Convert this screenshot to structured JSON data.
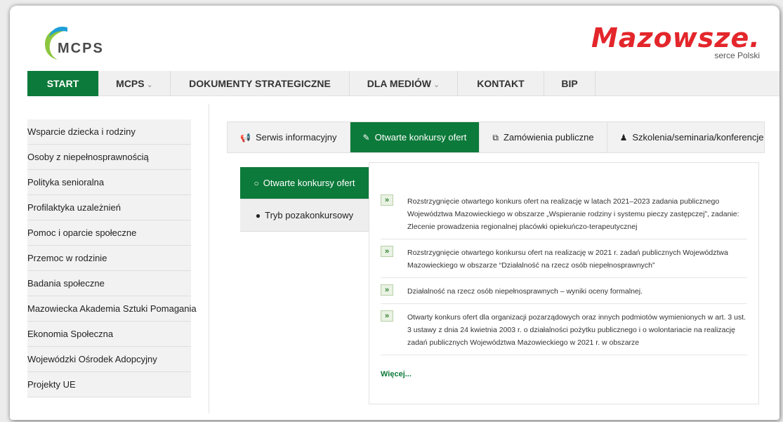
{
  "header": {
    "mcps_logo_text": "MCPS",
    "mazowsze_logo_text": "Mazowsze.",
    "mazowsze_tagline": "serce Polski"
  },
  "nav": {
    "items": [
      {
        "label": "START",
        "active": true,
        "dropdown": false
      },
      {
        "label": "MCPS",
        "active": false,
        "dropdown": true
      },
      {
        "label": "DOKUMENTY STRATEGICZNE",
        "active": false,
        "dropdown": false
      },
      {
        "label": "DLA MEDIÓW",
        "active": false,
        "dropdown": true
      },
      {
        "label": "KONTAKT",
        "active": false,
        "dropdown": false
      },
      {
        "label": "BIP",
        "active": false,
        "dropdown": false
      }
    ]
  },
  "sidebar": {
    "items": [
      {
        "label": "Wsparcie dziecka i rodziny"
      },
      {
        "label": "Osoby z niepełnosprawnością"
      },
      {
        "label": "Polityka senioralna"
      },
      {
        "label": "Profilaktyka uzależnień"
      },
      {
        "label": "Pomoc i oparcie społeczne"
      },
      {
        "label": "Przemoc w rodzinie"
      },
      {
        "label": "Badania społeczne"
      },
      {
        "label": "Mazowiecka Akademia Sztuki Pomagania"
      },
      {
        "label": "Ekonomia Społeczna"
      },
      {
        "label": "Wojewódzki Ośrodek Adopcyjny"
      },
      {
        "label": "Projekty UE"
      }
    ]
  },
  "tabs": [
    {
      "label": "Serwis informacyjny",
      "icon": "megaphone-icon",
      "glyph": "📢",
      "active": false
    },
    {
      "label": "Otwarte konkursy ofert",
      "icon": "edit-icon",
      "glyph": "✎",
      "active": true
    },
    {
      "label": "Zamówienia publiczne",
      "icon": "copy-icon",
      "glyph": "⧉",
      "active": false
    },
    {
      "label": "Szkolenia/seminaria/konferencje",
      "icon": "user-icon",
      "glyph": "♟",
      "active": false
    }
  ],
  "subtabs": [
    {
      "label": "Otwarte konkursy ofert",
      "icon": "comment-outline-icon",
      "glyph": "○",
      "active": true
    },
    {
      "label": "Tryb pozakonkursowy",
      "icon": "comment-icon",
      "glyph": "●",
      "active": false
    }
  ],
  "news": [
    {
      "text": "Rozstrzygnięcie otwartego konkurs ofert na realizację w latach 2021–2023 zadania publicznego Województwa Mazowieckiego w obszarze „Wspieranie rodziny i systemu pieczy zastępczej”, zadanie: Zlecenie prowadzenia regionalnej placówki opiekuńczo-terapeutycznej"
    },
    {
      "text": "Rozstrzygnięcie otwartego konkursu ofert na realizację w 2021 r. zadań publicznych Województwa Mazowieckiego w obszarze “Działalność na rzecz osób niepełnosprawnych”"
    },
    {
      "text": "Działalność na rzecz osób niepełnosprawnych – wyniki oceny formalnej."
    },
    {
      "text": "Otwarty konkurs ofert dla organizacji pozarządowych oraz innych podmiotów wymienionych w art. 3 ust. 3 ustawy z dnia 24 kwietnia 2003 r. o działalności pożytku publicznego i o wolontariacie na realizację zadań publicznych Województwa Mazowieckiego w 2021 r. w obszarze"
    }
  ],
  "bullet_glyph": "»",
  "more_label": "Więcej...",
  "colors": {
    "accent": "#0c7a3a",
    "brand_red": "#e3262b"
  }
}
